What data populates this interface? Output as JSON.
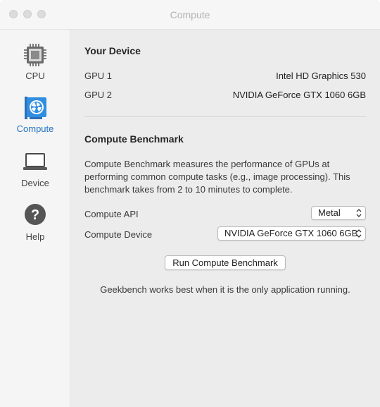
{
  "window": {
    "title": "Compute"
  },
  "sidebar": {
    "items": [
      {
        "label": "CPU",
        "icon": "cpu-chip-icon",
        "selected": false
      },
      {
        "label": "Compute",
        "icon": "gpu-card-icon",
        "selected": true
      },
      {
        "label": "Device",
        "icon": "laptop-icon",
        "selected": false
      },
      {
        "label": "Help",
        "icon": "question-mark-icon",
        "selected": false
      }
    ]
  },
  "your_device": {
    "heading": "Your Device",
    "rows": [
      {
        "label": "GPU 1",
        "value": "Intel HD Graphics 530"
      },
      {
        "label": "GPU 2",
        "value": "NVIDIA GeForce GTX 1060 6GB"
      }
    ]
  },
  "benchmark": {
    "heading": "Compute Benchmark",
    "description": "Compute Benchmark measures the performance of GPUs at performing common compute tasks (e.g., image processing). This benchmark takes from 2 to 10 minutes to complete.",
    "api": {
      "label": "Compute API",
      "selected": "Metal"
    },
    "device": {
      "label": "Compute Device",
      "selected": "NVIDIA GeForce GTX 1060 6GB"
    },
    "run_button": "Run Compute Benchmark",
    "note": "Geekbench works best when it is the only application running."
  },
  "colors": {
    "accent": "#2473c2",
    "sidebar_bg": "#f5f5f5",
    "content_bg": "#ececec"
  }
}
